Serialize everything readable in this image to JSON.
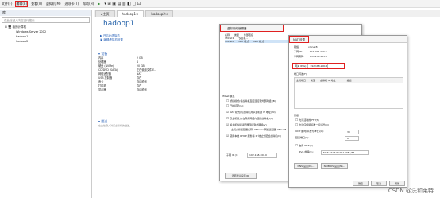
{
  "menu": {
    "file": "文件(F)",
    "edit": "编辑(E)",
    "view": "查看(V)",
    "vm": "虚拟机(M)",
    "tabs": "选项卡(T)",
    "help": "帮助(H)"
  },
  "tabs": {
    "home": "主页",
    "t1": "hadoop1",
    "t2": "hadoop2"
  },
  "library": {
    "title": "库",
    "search": "在此处键入内容进行搜索",
    "root": "我的计算机",
    "items": [
      "Windows Server 2012",
      "hadoop1",
      "hadoop2"
    ]
  },
  "vm": {
    "name": "hadoop1",
    "power_on": "开启此虚拟机",
    "edit_settings": "编辑虚拟机设置"
  },
  "devices": {
    "title": "设备",
    "rows": [
      [
        "内存",
        "2 GB"
      ],
      [
        "处理器",
        "4"
      ],
      [
        "硬盘 (NVMe)",
        "20 GB"
      ],
      [
        "CD/DVD (SATA)",
        "正在使用文件 E..."
      ],
      [
        "网络适配器",
        "NAT"
      ],
      [
        "USB 控制器",
        "存在"
      ],
      [
        "声卡",
        "自动检测"
      ],
      [
        "打印机",
        "存在"
      ],
      [
        "显示器",
        "自动检测"
      ]
    ]
  },
  "description": {
    "title": "描述",
    "placeholder": "在此处键入对该虚拟机的描述。"
  },
  "vne": {
    "title": "虚拟网络编辑器",
    "cols": [
      "名称",
      "类型",
      "外部连接"
    ],
    "rows": [
      [
        "VMnet1",
        "仅主机...",
        "-"
      ],
      [
        "VMnet8",
        "NAT 模式",
        "NAT 模式"
      ]
    ],
    "settings_title": "VMnet 信息",
    "bridge": "桥接模式(将虚拟机直接连接到外部网络)(B)",
    "bridge_to": "已桥接至(G):",
    "nat": "NAT 模式(与虚拟机共享主机的 IP 地址)(N)",
    "host_only": "仅主机模式(在专用网络内连接虚拟机)(H)",
    "connect_adapter": "将主机虚拟适配器连接到此网络(V)",
    "adapter_name": "主机虚拟适配器名称: VMware 网络适配器 VMnet8",
    "dhcp": "使用本地 DHCP 服务将 IP 地址分配给虚拟机(D)",
    "subnet_ip_label": "子网 IP (I):",
    "subnet_ip": "192.168.200.0",
    "restore": "还原默认设置(R)"
  },
  "nat": {
    "title": "NAT 设置",
    "network_label": "网络:",
    "network": "vmnet8",
    "subnet_ip_label": "子网 IP:",
    "subnet_ip": "192.168.200.0",
    "mask_label": "子网掩码:",
    "mask": "255.255.255.0",
    "gateway_label": "网关 IP(G):",
    "gateway": "192.168.200.2",
    "port_fwd": "端口转发(F)",
    "cols": [
      "主机端口",
      "类型",
      "虚拟机 IP 地址",
      "描述"
    ],
    "advanced": "高级",
    "allow_ftp": "允许活动的 FTP(T)",
    "allow_oui": "允许任何组织唯一标识符(O)",
    "udp_label": "UDP 超时(以秒为单位)(U):",
    "udp": "30",
    "cfg_label": "配置端口(C):",
    "cfg": "0",
    "ipv6": "启用 IPv6(E)",
    "ipv6_prefix_label": "IPv6 前缀(6):",
    "ipv6_prefix": "fd15:4ba5:5a2b:1008::/64",
    "dns": "DNS 设置(D)...",
    "netbios": "NetBIOS 设置(N)...",
    "ok": "确定",
    "cancel": "取消",
    "help": "帮助"
  },
  "watermark": "CSDN @沃和莱特"
}
